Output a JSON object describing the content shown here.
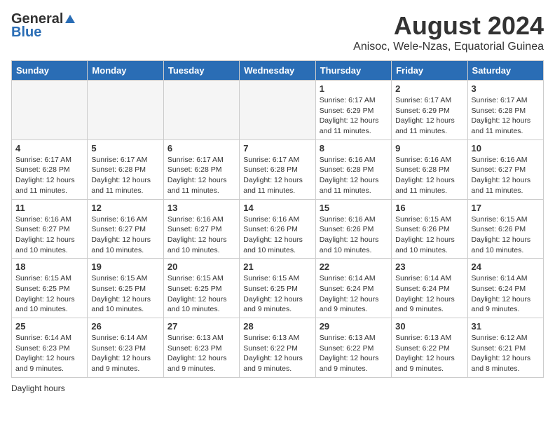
{
  "header": {
    "logo_general": "General",
    "logo_blue": "Blue",
    "month_year": "August 2024",
    "location": "Anisoc, Wele-Nzas, Equatorial Guinea"
  },
  "days_of_week": [
    "Sunday",
    "Monday",
    "Tuesday",
    "Wednesday",
    "Thursday",
    "Friday",
    "Saturday"
  ],
  "footer": {
    "daylight_hours_label": "Daylight hours"
  },
  "weeks": [
    {
      "days": [
        {
          "num": "",
          "info": ""
        },
        {
          "num": "",
          "info": ""
        },
        {
          "num": "",
          "info": ""
        },
        {
          "num": "",
          "info": ""
        },
        {
          "num": "1",
          "info": "Sunrise: 6:17 AM\nSunset: 6:29 PM\nDaylight: 12 hours\nand 11 minutes."
        },
        {
          "num": "2",
          "info": "Sunrise: 6:17 AM\nSunset: 6:29 PM\nDaylight: 12 hours\nand 11 minutes."
        },
        {
          "num": "3",
          "info": "Sunrise: 6:17 AM\nSunset: 6:28 PM\nDaylight: 12 hours\nand 11 minutes."
        }
      ]
    },
    {
      "days": [
        {
          "num": "4",
          "info": "Sunrise: 6:17 AM\nSunset: 6:28 PM\nDaylight: 12 hours\nand 11 minutes."
        },
        {
          "num": "5",
          "info": "Sunrise: 6:17 AM\nSunset: 6:28 PM\nDaylight: 12 hours\nand 11 minutes."
        },
        {
          "num": "6",
          "info": "Sunrise: 6:17 AM\nSunset: 6:28 PM\nDaylight: 12 hours\nand 11 minutes."
        },
        {
          "num": "7",
          "info": "Sunrise: 6:17 AM\nSunset: 6:28 PM\nDaylight: 12 hours\nand 11 minutes."
        },
        {
          "num": "8",
          "info": "Sunrise: 6:16 AM\nSunset: 6:28 PM\nDaylight: 12 hours\nand 11 minutes."
        },
        {
          "num": "9",
          "info": "Sunrise: 6:16 AM\nSunset: 6:28 PM\nDaylight: 12 hours\nand 11 minutes."
        },
        {
          "num": "10",
          "info": "Sunrise: 6:16 AM\nSunset: 6:27 PM\nDaylight: 12 hours\nand 11 minutes."
        }
      ]
    },
    {
      "days": [
        {
          "num": "11",
          "info": "Sunrise: 6:16 AM\nSunset: 6:27 PM\nDaylight: 12 hours\nand 10 minutes."
        },
        {
          "num": "12",
          "info": "Sunrise: 6:16 AM\nSunset: 6:27 PM\nDaylight: 12 hours\nand 10 minutes."
        },
        {
          "num": "13",
          "info": "Sunrise: 6:16 AM\nSunset: 6:27 PM\nDaylight: 12 hours\nand 10 minutes."
        },
        {
          "num": "14",
          "info": "Sunrise: 6:16 AM\nSunset: 6:26 PM\nDaylight: 12 hours\nand 10 minutes."
        },
        {
          "num": "15",
          "info": "Sunrise: 6:16 AM\nSunset: 6:26 PM\nDaylight: 12 hours\nand 10 minutes."
        },
        {
          "num": "16",
          "info": "Sunrise: 6:15 AM\nSunset: 6:26 PM\nDaylight: 12 hours\nand 10 minutes."
        },
        {
          "num": "17",
          "info": "Sunrise: 6:15 AM\nSunset: 6:26 PM\nDaylight: 12 hours\nand 10 minutes."
        }
      ]
    },
    {
      "days": [
        {
          "num": "18",
          "info": "Sunrise: 6:15 AM\nSunset: 6:25 PM\nDaylight: 12 hours\nand 10 minutes."
        },
        {
          "num": "19",
          "info": "Sunrise: 6:15 AM\nSunset: 6:25 PM\nDaylight: 12 hours\nand 10 minutes."
        },
        {
          "num": "20",
          "info": "Sunrise: 6:15 AM\nSunset: 6:25 PM\nDaylight: 12 hours\nand 10 minutes."
        },
        {
          "num": "21",
          "info": "Sunrise: 6:15 AM\nSunset: 6:25 PM\nDaylight: 12 hours\nand 9 minutes."
        },
        {
          "num": "22",
          "info": "Sunrise: 6:14 AM\nSunset: 6:24 PM\nDaylight: 12 hours\nand 9 minutes."
        },
        {
          "num": "23",
          "info": "Sunrise: 6:14 AM\nSunset: 6:24 PM\nDaylight: 12 hours\nand 9 minutes."
        },
        {
          "num": "24",
          "info": "Sunrise: 6:14 AM\nSunset: 6:24 PM\nDaylight: 12 hours\nand 9 minutes."
        }
      ]
    },
    {
      "days": [
        {
          "num": "25",
          "info": "Sunrise: 6:14 AM\nSunset: 6:23 PM\nDaylight: 12 hours\nand 9 minutes."
        },
        {
          "num": "26",
          "info": "Sunrise: 6:14 AM\nSunset: 6:23 PM\nDaylight: 12 hours\nand 9 minutes."
        },
        {
          "num": "27",
          "info": "Sunrise: 6:13 AM\nSunset: 6:23 PM\nDaylight: 12 hours\nand 9 minutes."
        },
        {
          "num": "28",
          "info": "Sunrise: 6:13 AM\nSunset: 6:22 PM\nDaylight: 12 hours\nand 9 minutes."
        },
        {
          "num": "29",
          "info": "Sunrise: 6:13 AM\nSunset: 6:22 PM\nDaylight: 12 hours\nand 9 minutes."
        },
        {
          "num": "30",
          "info": "Sunrise: 6:13 AM\nSunset: 6:22 PM\nDaylight: 12 hours\nand 9 minutes."
        },
        {
          "num": "31",
          "info": "Sunrise: 6:12 AM\nSunset: 6:21 PM\nDaylight: 12 hours\nand 8 minutes."
        }
      ]
    }
  ]
}
